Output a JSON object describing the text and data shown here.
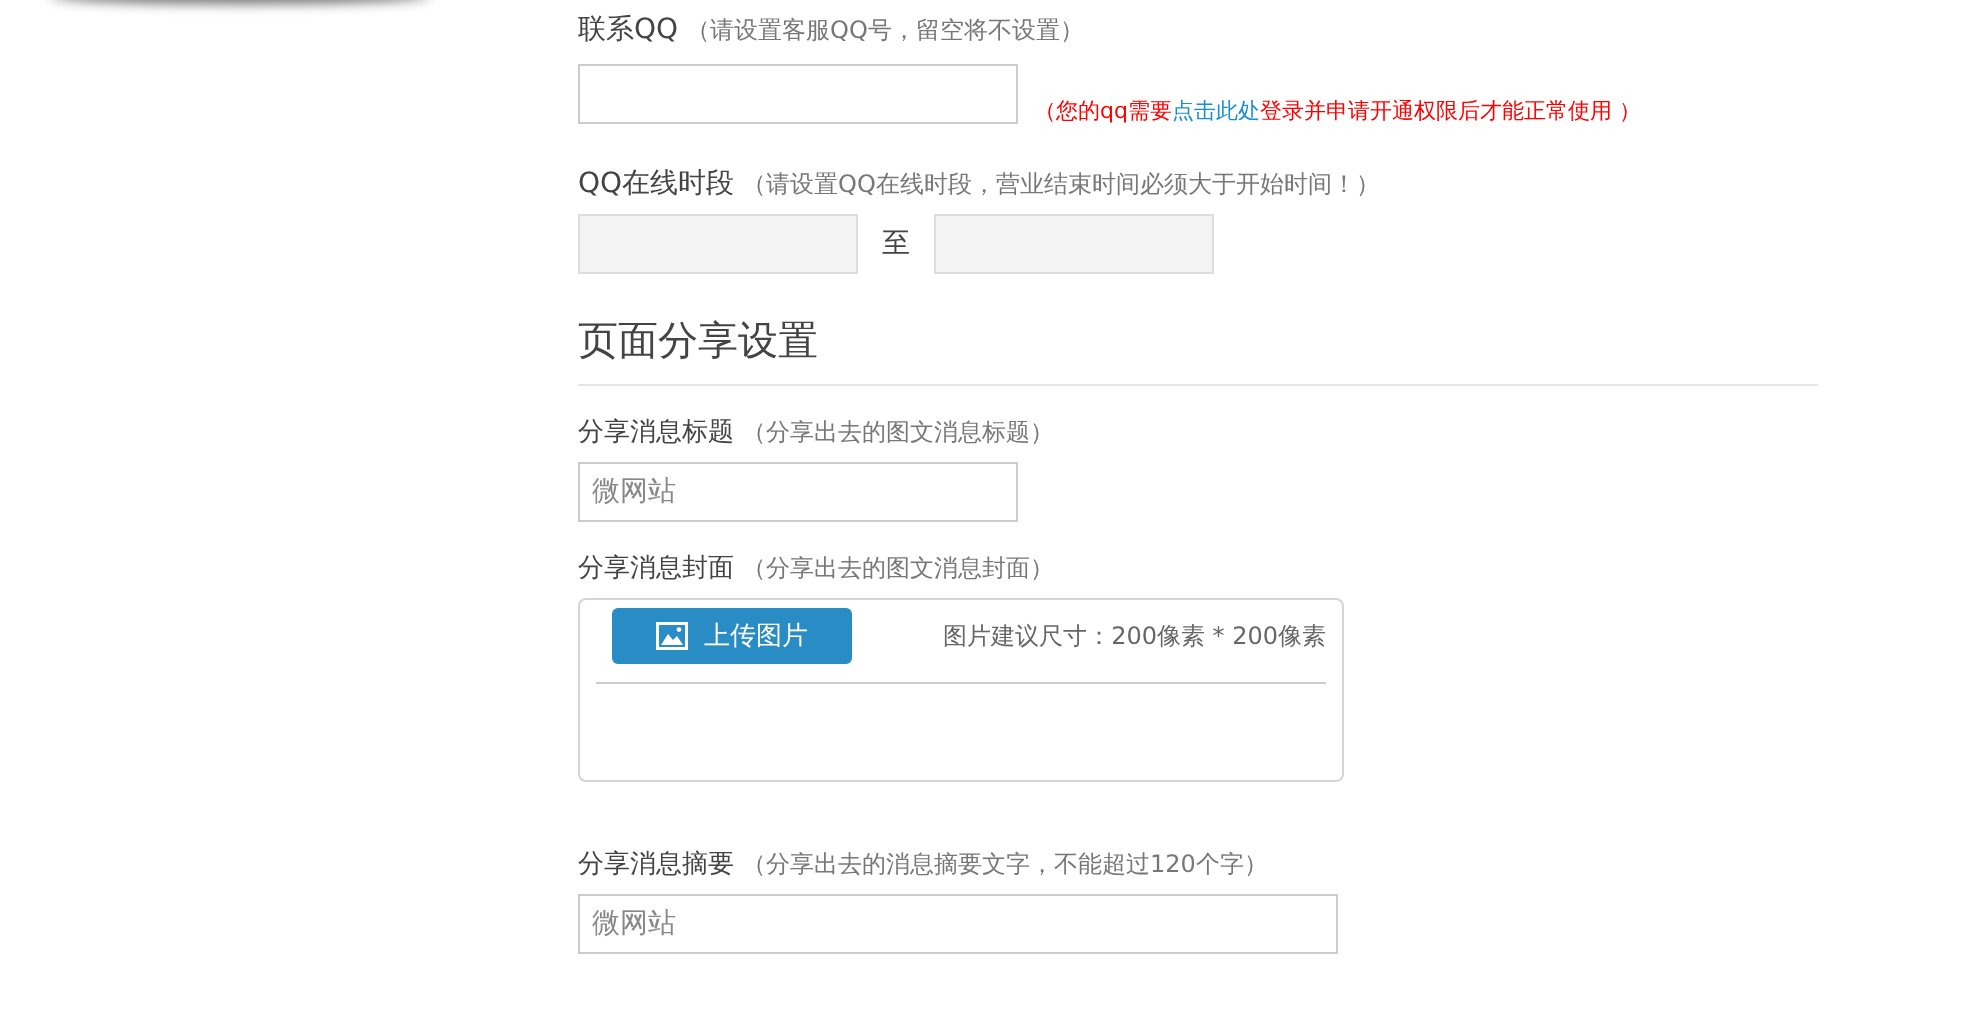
{
  "contact_qq": {
    "label": "联系QQ",
    "hint": "（请设置客服QQ号，留空将不设置）",
    "value_field": {
      "disabled": false
    },
    "note": {
      "before": "（您的qq需要",
      "link": "点击此处",
      "after": "登录并申请开通权限后才能正常使用 ）"
    }
  },
  "qq_online_hours": {
    "label": "QQ在线时段",
    "hint": "（请设置QQ在线时段，营业结束时间必须大于开始时间！）",
    "start": {
      "disabled": true
    },
    "separator": "至",
    "end": {
      "disabled": true
    }
  },
  "section_title": "页面分享设置",
  "share_title": {
    "label": "分享消息标题",
    "hint": "（分享出去的图文消息标题）",
    "value": "微网站"
  },
  "share_cover": {
    "label": "分享消息封面",
    "hint": "（分享出去的图文消息封面）",
    "upload_button": "上传图片",
    "size_hint": "图片建议尺寸：200像素 * 200像素"
  },
  "share_summary": {
    "label": "分享消息摘要",
    "hint": "（分享出去的消息摘要文字，不能超过120个字）",
    "value": "微网站"
  }
}
